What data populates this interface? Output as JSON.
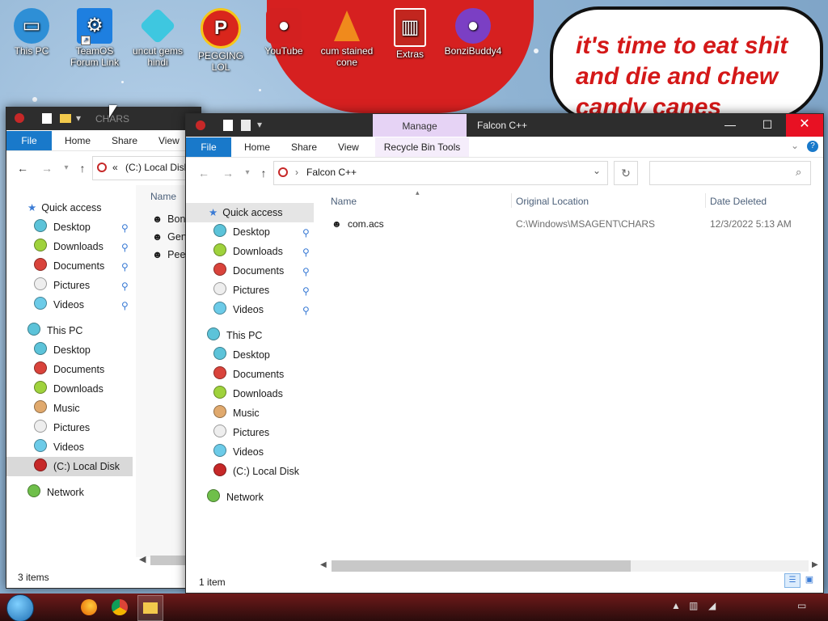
{
  "desktop": {
    "icons": [
      {
        "label": "This PC",
        "icon": "monitor-icon",
        "color": "#2e8fd6"
      },
      {
        "label": "TeamOS Forum Link",
        "icon": "gear-icon",
        "color": "#1e7fe0"
      },
      {
        "label": "uncut gems hindi",
        "icon": "diamond-icon",
        "color": "#3ec7e0"
      },
      {
        "label": "PEGGING LOL",
        "icon": "p-badge-icon",
        "color": "#d9261c"
      },
      {
        "label": "YouTube",
        "icon": "angry-bird-icon",
        "color": "#d32020"
      },
      {
        "label": "cum stained cone",
        "icon": "traffic-cone-icon",
        "color": "#f08a1c"
      },
      {
        "label": "Extras",
        "icon": "card-icon",
        "color": "#c2261f"
      },
      {
        "label": "BonziBuddy4",
        "icon": "purple-gorilla-icon",
        "color": "#7b3fc4"
      }
    ],
    "bubble_text": "it's time to eat shit and die and chew candy canes"
  },
  "back_window": {
    "title": "CHARS",
    "tabs": {
      "file": "File",
      "home": "Home",
      "share": "Share",
      "view": "View"
    },
    "address": {
      "prefix": "«",
      "path": "(C:) Local Disk"
    },
    "column_name": "Name",
    "files": [
      "Bonz",
      "Gen",
      "Peed"
    ],
    "quick_access": {
      "label": "Quick access",
      "items": [
        "Desktop",
        "Downloads",
        "Documents",
        "Pictures",
        "Videos"
      ]
    },
    "this_pc": {
      "label": "This PC",
      "items": [
        "Desktop",
        "Documents",
        "Downloads",
        "Music",
        "Pictures",
        "Videos",
        "(C:) Local Disk"
      ]
    },
    "network": "Network",
    "status": "3 items"
  },
  "front_window": {
    "title": "Falcon C++",
    "manage_tab": "Manage",
    "tabs": {
      "file": "File",
      "home": "Home",
      "share": "Share",
      "view": "View",
      "recycle_bin_tools": "Recycle Bin Tools"
    },
    "address": {
      "path": "Falcon C++"
    },
    "columns": {
      "name": "Name",
      "original_location": "Original Location",
      "date_deleted": "Date Deleted"
    },
    "rows": [
      {
        "name": "com.acs",
        "original_location": "C:\\Windows\\MSAGENT\\CHARS",
        "date_deleted": "12/3/2022 5:13 AM"
      }
    ],
    "quick_access": {
      "label": "Quick access",
      "items": [
        "Desktop",
        "Downloads",
        "Documents",
        "Pictures",
        "Videos"
      ]
    },
    "this_pc": {
      "label": "This PC",
      "items": [
        "Desktop",
        "Documents",
        "Downloads",
        "Music",
        "Pictures",
        "Videos",
        "(C:) Local Disk"
      ]
    },
    "network": "Network",
    "status": "1 item"
  },
  "taskbar": {
    "start": "start-orb-icon",
    "pinned": [
      "firefox-icon",
      "chrome-icon",
      "file-explorer-icon"
    ]
  },
  "colors": {
    "accent": "#1979ca",
    "manage_tab": "#e6d3f5",
    "titlebar": "#2d2d2d",
    "close_button": "#e81123"
  }
}
